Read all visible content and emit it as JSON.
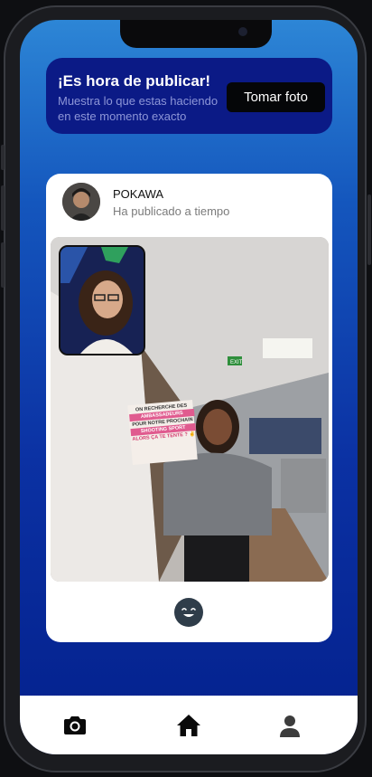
{
  "banner": {
    "title": "¡Es hora de publicar!",
    "subtitle": "Muestra lo que estas haciendo en este momento exacto",
    "button_label": "Tomar foto"
  },
  "post": {
    "username": "POKAWA",
    "status": "Ha publicado a tiempo",
    "sign_lines": [
      "ON RECHERCHE DES",
      "AMBASSADEURS",
      "POUR NOTRE PROCHAIN",
      "SHOOTING SPORT",
      "ALORS ÇA TE TENTE ? ✌"
    ],
    "exit_sign": "EXIT"
  },
  "nav": {
    "items": [
      "camera-icon",
      "home-icon",
      "profile-icon"
    ]
  },
  "colors": {
    "banner_bg": "#0b1a86",
    "screen_gradient_top": "#2d86d6",
    "screen_gradient_bottom": "#03208c",
    "button_bg": "#050608"
  }
}
